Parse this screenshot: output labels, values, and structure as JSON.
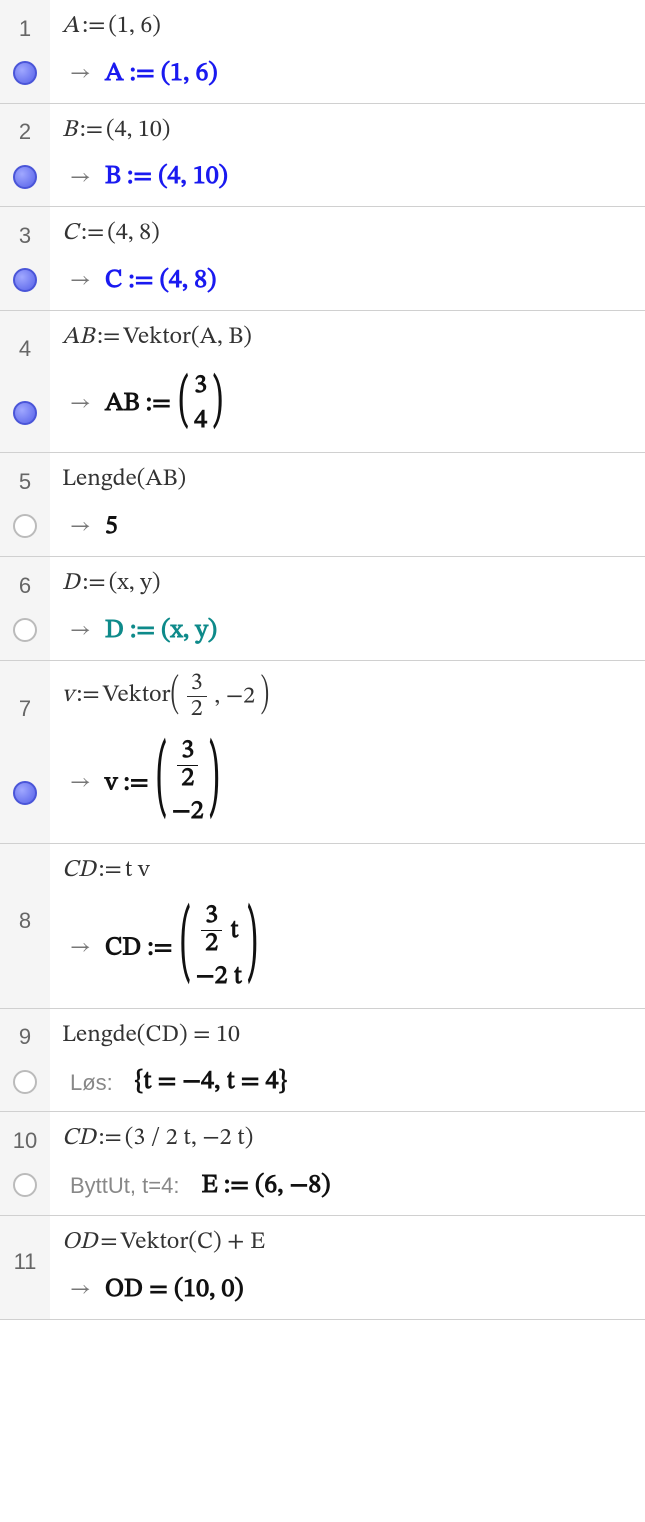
{
  "rows": [
    {
      "num": "1",
      "filled": true,
      "inputA": "A",
      "inputOp": ":=",
      "inputRest": " (1, 6)",
      "outMode": "arrow",
      "outText": "A  :=  (1, 6)",
      "outClass": "blue"
    },
    {
      "num": "2",
      "filled": true,
      "inputA": "B",
      "inputOp": ":=",
      "inputRest": " (4, 10)",
      "outMode": "arrow",
      "outText": "B  :=  (4, 10)",
      "outClass": "blue"
    },
    {
      "num": "3",
      "filled": true,
      "inputA": "C",
      "inputOp": ":=",
      "inputRest": " (4, 8)",
      "outMode": "arrow",
      "outText": "C  :=  (4, 8)",
      "outClass": "blue"
    },
    {
      "num": "4",
      "filled": true,
      "special": "row4",
      "vec4_top": "3",
      "vec4_bot": "4",
      "inputA": "AB",
      "inputOp": ":=",
      "inputRest": " Vektor(A, B)",
      "outPrefixA": "AB  := "
    },
    {
      "num": "5",
      "filled": false,
      "gray": true,
      "inputA": "",
      "inputOp": "",
      "inputRest": "Lengde(AB)",
      "outMode": "arrow",
      "outText": "5",
      "outClass": "black"
    },
    {
      "num": "6",
      "filled": false,
      "gray": true,
      "inputA": "D",
      "inputOp": ":=",
      "inputRest": " (x, y)",
      "outMode": "arrow",
      "outText": "D  :=  (x, y)",
      "outClass": "teal"
    },
    {
      "num": "7",
      "filled": true,
      "special": "row7",
      "inFracTop": "3",
      "inFracBot": "2",
      "inSecond": "−2",
      "outFracTop": "3",
      "outFracBot": "2",
      "outBot": "−2",
      "inputA": "v",
      "inputOp": ":=",
      "inputFunc": " Vektor",
      "outPrefixA": "v  := "
    },
    {
      "num": "8",
      "filled": false,
      "nobubble": true,
      "special": "row8",
      "inputA": "CD",
      "inputOp": ":=",
      "inputRest": " t v",
      "outFracTop": "3",
      "outFracBot": "2",
      "t": " t",
      "outBot": "−2 t",
      "outPrefixA": "CD  := "
    },
    {
      "num": "9",
      "filled": false,
      "gray": true,
      "inputA": "",
      "inputOp": "",
      "inputRest": "Lengde(CD)  =  10",
      "outMode": "prefix",
      "prefix": "Løs:",
      "outText": "{t = −4, t = 4}",
      "outClass": "black"
    },
    {
      "num": "10",
      "filled": false,
      "gray": true,
      "inputA": "CD",
      "inputOp": ":=",
      "inputRest": " (3 / 2 t,  −2 t)",
      "outMode": "prefix",
      "prefix": "ByttUt, t=4:",
      "outText": "E  :=  (6, −8)",
      "outClass": "black"
    },
    {
      "num": "11",
      "filled": false,
      "nobubble": true,
      "inputA": "OD",
      "inputOp": " = ",
      "inputRest": " Vektor(C) + E",
      "outMode": "arrow",
      "outText": "OD = (10, 0)",
      "outClass": "black"
    }
  ]
}
